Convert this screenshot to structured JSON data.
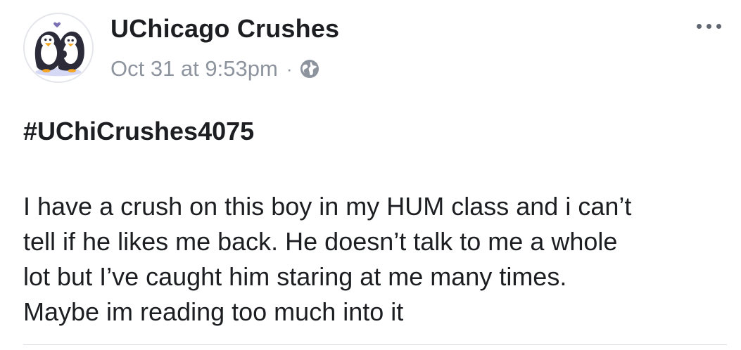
{
  "post": {
    "author": "UChicago Crushes",
    "timestamp": "Oct 31 at 9:53pm",
    "separator": "·",
    "privacy_icon": "globe-icon",
    "more_icon": "more-options-icon",
    "hashtag": "#UChiCrushes4075",
    "body_lines": [
      "I have a crush on this boy in my HUM class and i can’t",
      "tell if he likes me back. He doesn’t talk to me a whole",
      "lot but I’ve caught him staring at me many times.",
      "Maybe im reading too much into it"
    ]
  },
  "colors": {
    "text": "#1c1e21",
    "meta": "#8d949e",
    "divider": "#dadde1"
  }
}
